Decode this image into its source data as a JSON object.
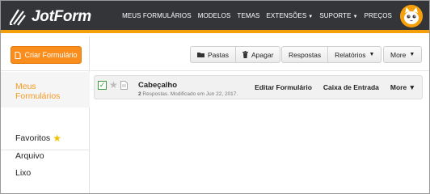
{
  "colors": {
    "brand_orange": "#f5a00b",
    "topbar_bg": "#333539",
    "active_nav": "#f59a23",
    "create_button": "#f98e1f"
  },
  "header": {
    "logo_text": "JotForm",
    "nav": [
      {
        "label": "MEUS FORMULÁRIOS",
        "caret": ""
      },
      {
        "label": "MODELOS",
        "caret": ""
      },
      {
        "label": "TEMAS",
        "caret": ""
      },
      {
        "label": "EXTENSÕES",
        "caret": "▼"
      },
      {
        "label": "SUPORTE",
        "caret": "▼"
      },
      {
        "label": "PREÇOS",
        "caret": ""
      }
    ],
    "avatar_icon": "cat-avatar-icon"
  },
  "sidebar": {
    "create_label": "Criar Formulário",
    "active_item_line1": "Meus",
    "active_item_line2": "Formulários",
    "items": [
      "Favoritos",
      "Arquivo",
      "Lixo"
    ]
  },
  "toolbar": {
    "folders_label": "Pastas",
    "delete_label": "Apagar",
    "responses_label": "Respostas",
    "reports_label": "Relatórios",
    "more_label": "More"
  },
  "forms": [
    {
      "title": "Cabeçalho",
      "responses_count": "2",
      "meta_text": " Respostas. Modificado em Jun 22, 2017.",
      "edit_label": "Editar Formulário",
      "inbox_label": "Caixa de Entrada",
      "more_label": "More"
    }
  ]
}
